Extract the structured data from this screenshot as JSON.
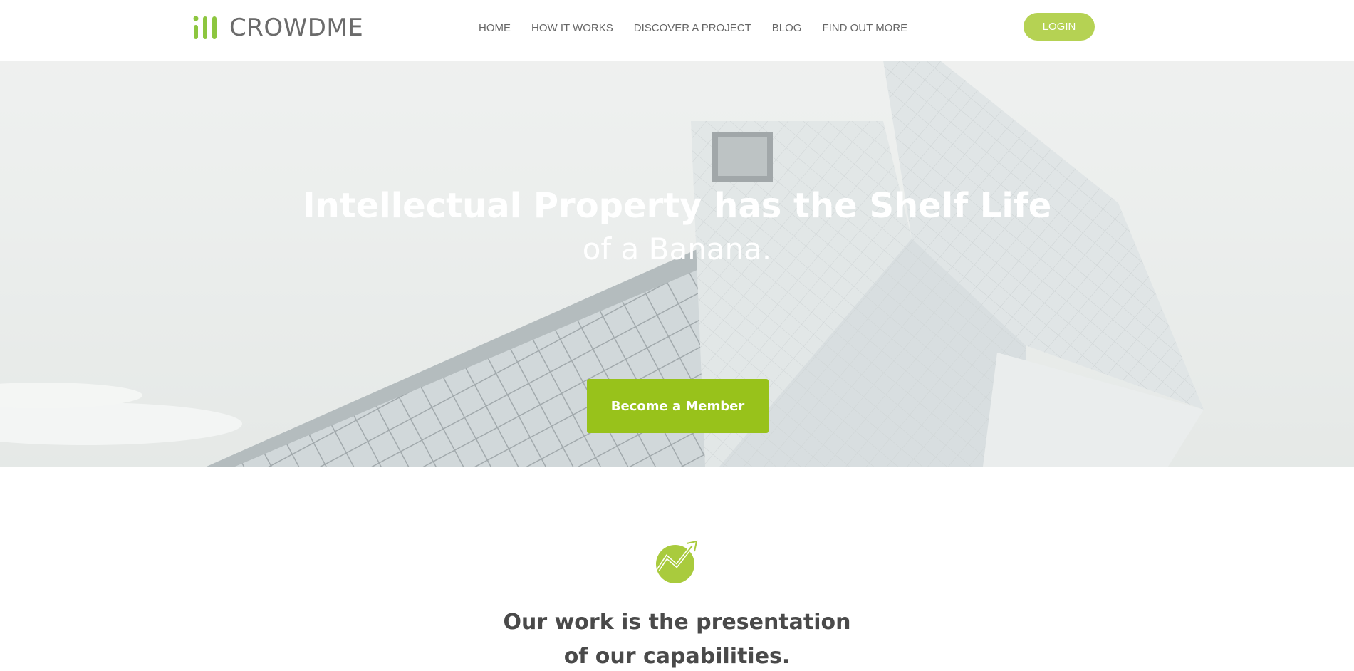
{
  "header": {
    "logo_text": "CROWDME",
    "nav": [
      "HOME",
      "HOW IT WORKS",
      "DISCOVER A PROJECT",
      "BLOG",
      "FIND OUT MORE"
    ],
    "login_label": "LOGIN"
  },
  "hero": {
    "title": "Intellectual Property has the Shelf Life",
    "subtitle": "of a Banana.",
    "cta_label": "Become a Member"
  },
  "section": {
    "title_line1": "Our work is the presentation",
    "title_line2": "of our capabilities."
  },
  "colors": {
    "accent": "#98c21b",
    "login_bg": "#b5d253",
    "logo_green": "#8dc63f",
    "text_dark": "#4a4a4a",
    "nav_text": "#666666"
  },
  "icons": {
    "logo": "bars-logo-icon",
    "feature": "growth-chart-icon"
  }
}
